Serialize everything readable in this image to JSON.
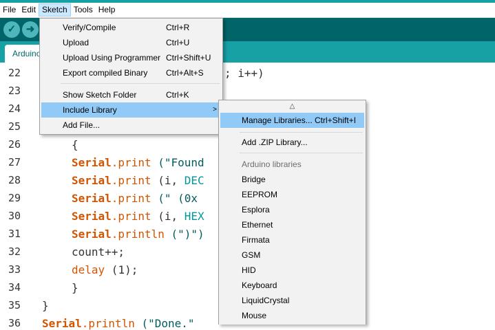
{
  "menubar": {
    "items": [
      "File",
      "Edit",
      "Sketch",
      "Tools",
      "Help"
    ],
    "active": "Sketch"
  },
  "toolbar": {
    "verify_icon": "checkmark-icon",
    "upload_icon": "arrow-right-icon"
  },
  "tab": {
    "label": "Arduino"
  },
  "editor": {
    "line_numbers": [
      "22",
      "23",
      "24",
      "25",
      "26",
      "27",
      "28",
      "29",
      "30",
      "31",
      "32",
      "33",
      "34",
      "35",
      "36"
    ],
    "line22": "; i++)",
    "line26": "{",
    "line27": {
      "kw": "Serial",
      "fn": ".print",
      "rest": " (\"Found"
    },
    "line28": {
      "kw": "Serial",
      "fn": ".print",
      "rest": " (i, ",
      "const": "DEC"
    },
    "line29": {
      "kw": "Serial",
      "fn": ".print",
      "rest": " (\" (0x"
    },
    "line30": {
      "kw": "Serial",
      "fn": ".print",
      "rest": " (i, ",
      "const": "HEX"
    },
    "line31": {
      "kw": "Serial",
      "fn": ".println",
      "rest": " (\")\")"
    },
    "line32": "count++;",
    "line33": {
      "fn": "delay",
      "rest": " (1);"
    },
    "line34": "}",
    "line35": "}",
    "line36": {
      "kw": "Serial",
      "fn": ".println",
      "rest": " (\"Done.\""
    }
  },
  "sketch_menu": {
    "verify": {
      "label": "Verify/Compile",
      "shortcut": "Ctrl+R"
    },
    "upload": {
      "label": "Upload",
      "shortcut": "Ctrl+U"
    },
    "upload_programmer": {
      "label": "Upload Using Programmer",
      "shortcut": "Ctrl+Shift+U"
    },
    "export_binary": {
      "label": "Export compiled Binary",
      "shortcut": "Ctrl+Alt+S"
    },
    "show_folder": {
      "label": "Show Sketch Folder",
      "shortcut": "Ctrl+K"
    },
    "include_library": {
      "label": "Include Library",
      "arrow": ">"
    },
    "add_file": {
      "label": "Add File..."
    }
  },
  "library_menu": {
    "scroll_up": "△",
    "manage": {
      "label": "Manage Libraries...",
      "shortcut": "Ctrl+Shift+I"
    },
    "add_zip": {
      "label": "Add .ZIP Library..."
    },
    "header": "Arduino libraries",
    "libraries": [
      "Bridge",
      "EEPROM",
      "Esplora",
      "Ethernet",
      "Firmata",
      "GSM",
      "HID",
      "Keyboard",
      "LiquidCrystal",
      "Mouse"
    ]
  },
  "colors": {
    "toolbar": "#006468",
    "tabbar": "#17a1a5",
    "menu_highlight": "#91c9f7",
    "keyword": "#d35400",
    "string": "#005c5f"
  }
}
